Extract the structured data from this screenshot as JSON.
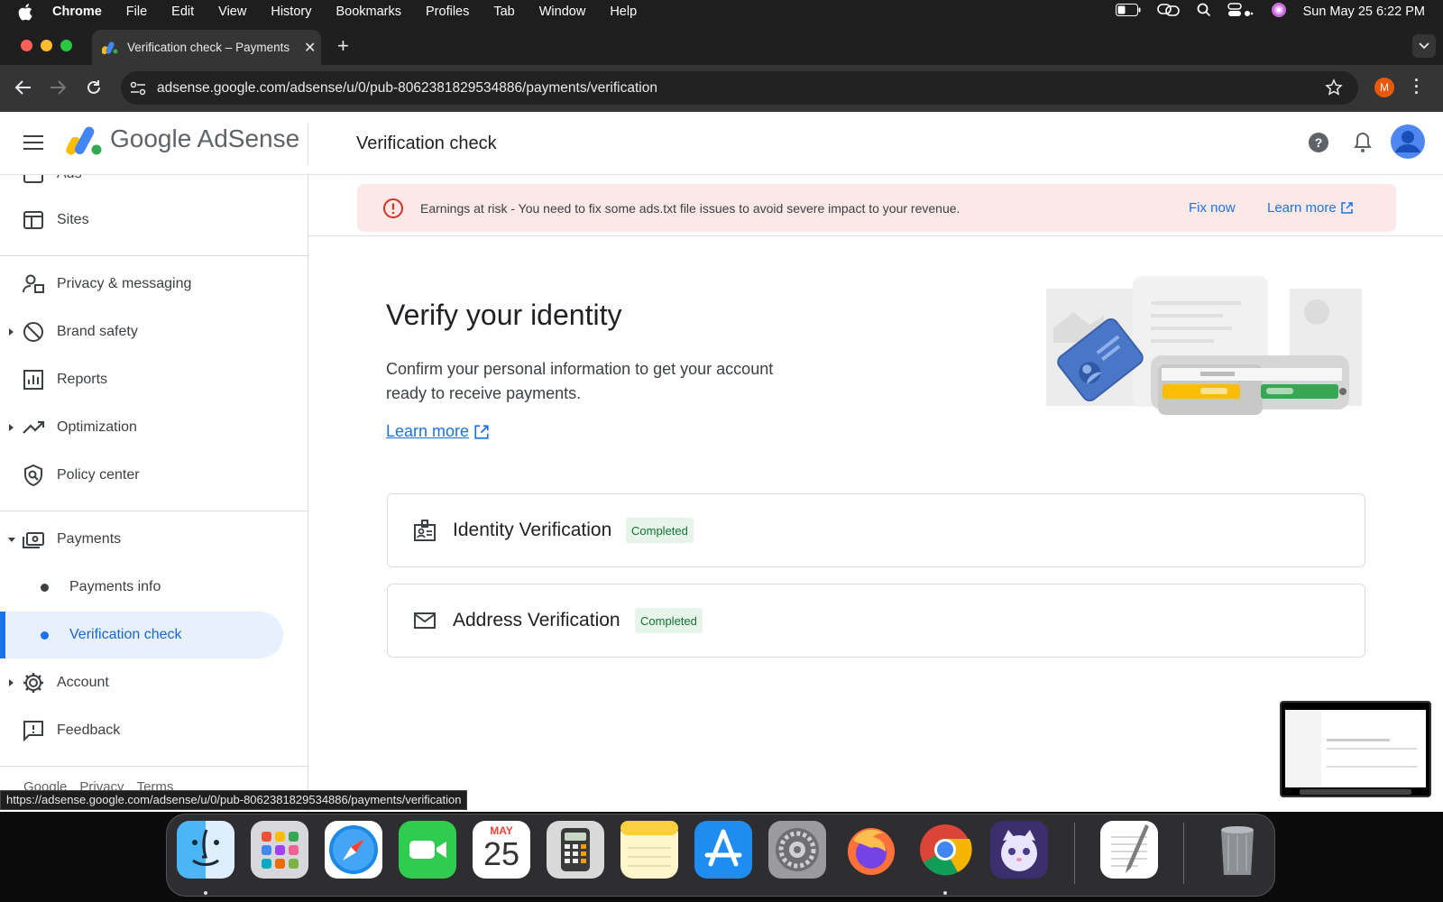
{
  "mac_menu": {
    "app": "Chrome",
    "items": [
      "File",
      "Edit",
      "View",
      "History",
      "Bookmarks",
      "Profiles",
      "Tab",
      "Window",
      "Help"
    ],
    "datetime": "Sun May 25  6:22 PM"
  },
  "browser": {
    "tab_title": "Verification check – Payments",
    "url": "adsense.google.com/adsense/u/0/pub-8062381829534886/payments/verification",
    "profile_initial": "M"
  },
  "app": {
    "logo": "Google AdSense",
    "page_title": "Verification check"
  },
  "sidebar": {
    "partial_top": "Ads",
    "items": [
      {
        "label": "Sites",
        "icon": "sites-icon"
      },
      {
        "label": "Privacy & messaging",
        "icon": "privacy-icon"
      },
      {
        "label": "Brand safety",
        "icon": "block-icon"
      },
      {
        "label": "Reports",
        "icon": "reports-icon"
      },
      {
        "label": "Optimization",
        "icon": "trending-icon"
      },
      {
        "label": "Policy center",
        "icon": "policy-icon"
      },
      {
        "label": "Payments",
        "icon": "payments-icon"
      },
      {
        "label": "Account",
        "icon": "gear-icon"
      },
      {
        "label": "Feedback",
        "icon": "feedback-icon"
      }
    ],
    "payments_sub": [
      "Payments info",
      "Verification check"
    ],
    "footer": [
      "Google",
      "Privacy",
      "Terms"
    ]
  },
  "alert": {
    "message": "Earnings at risk - You need to fix some ads.txt file issues to avoid severe impact to your revenue.",
    "fix_label": "Fix now",
    "learn_label": "Learn more"
  },
  "hero": {
    "title": "Verify your identity",
    "description": "Confirm your personal information to get your account ready to receive payments.",
    "link": "Learn more"
  },
  "verifications": [
    {
      "label": "Identity Verification",
      "status": "Completed",
      "icon": "id-badge-icon"
    },
    {
      "label": "Address Verification",
      "status": "Completed",
      "icon": "mail-icon"
    }
  ],
  "status_url": "https://adsense.google.com/adsense/u/0/pub-8062381829534886/payments/verification",
  "dock": {
    "calendar_month": "MAY",
    "calendar_day": "25"
  },
  "colors": {
    "accent": "#1a73e8",
    "selected_bg": "#e8f0fe",
    "alert_bg": "#fce8e6",
    "alert_icon": "#d93025",
    "badge_bg": "#e6f4ea",
    "badge_text": "#137333"
  }
}
